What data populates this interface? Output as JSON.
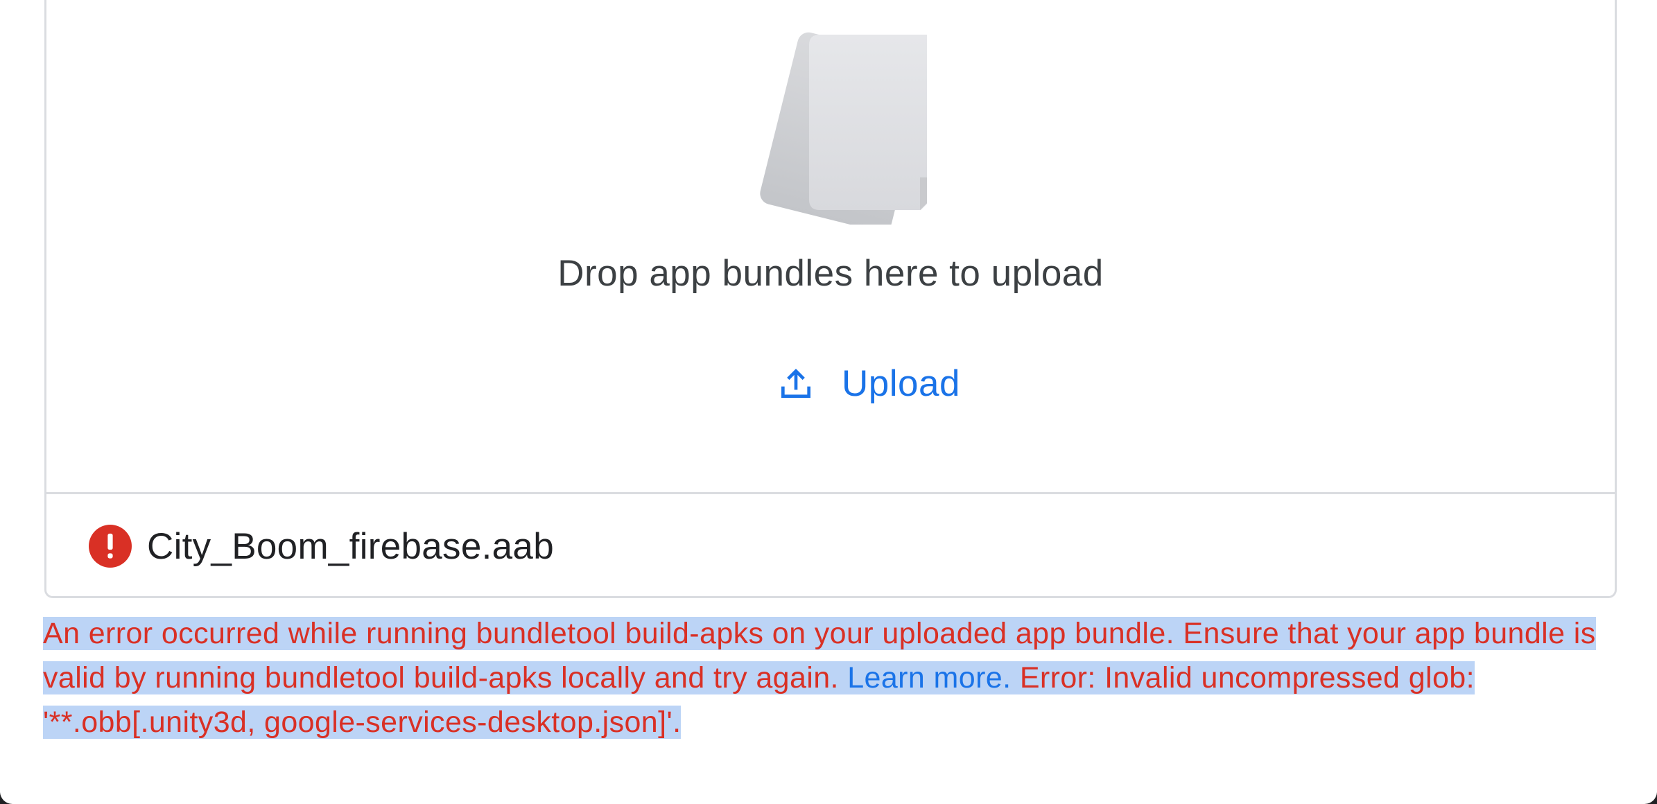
{
  "dropzone": {
    "illustration_icon": "app-bundle-files-icon",
    "instruction": "Drop app bundles here to upload",
    "upload_icon": "upload-icon",
    "upload_label": "Upload"
  },
  "file": {
    "status_icon": "error-icon",
    "name": "City_Boom_firebase.aab"
  },
  "error": {
    "text_before": "An error occurred while running bundletool build-apks on your uploaded app bundle. Ensure that your app bundle is valid by running bundletool build-apks locally and try again. ",
    "link_label": "Learn more.",
    "text_after": " Error: Invalid uncompressed glob: '**.obb[.unity3d, google-services-desktop.json]'."
  },
  "colors": {
    "error": "#d93025",
    "link": "#1a73e8",
    "selection": "#bcd4f6",
    "border": "#dadce0"
  }
}
